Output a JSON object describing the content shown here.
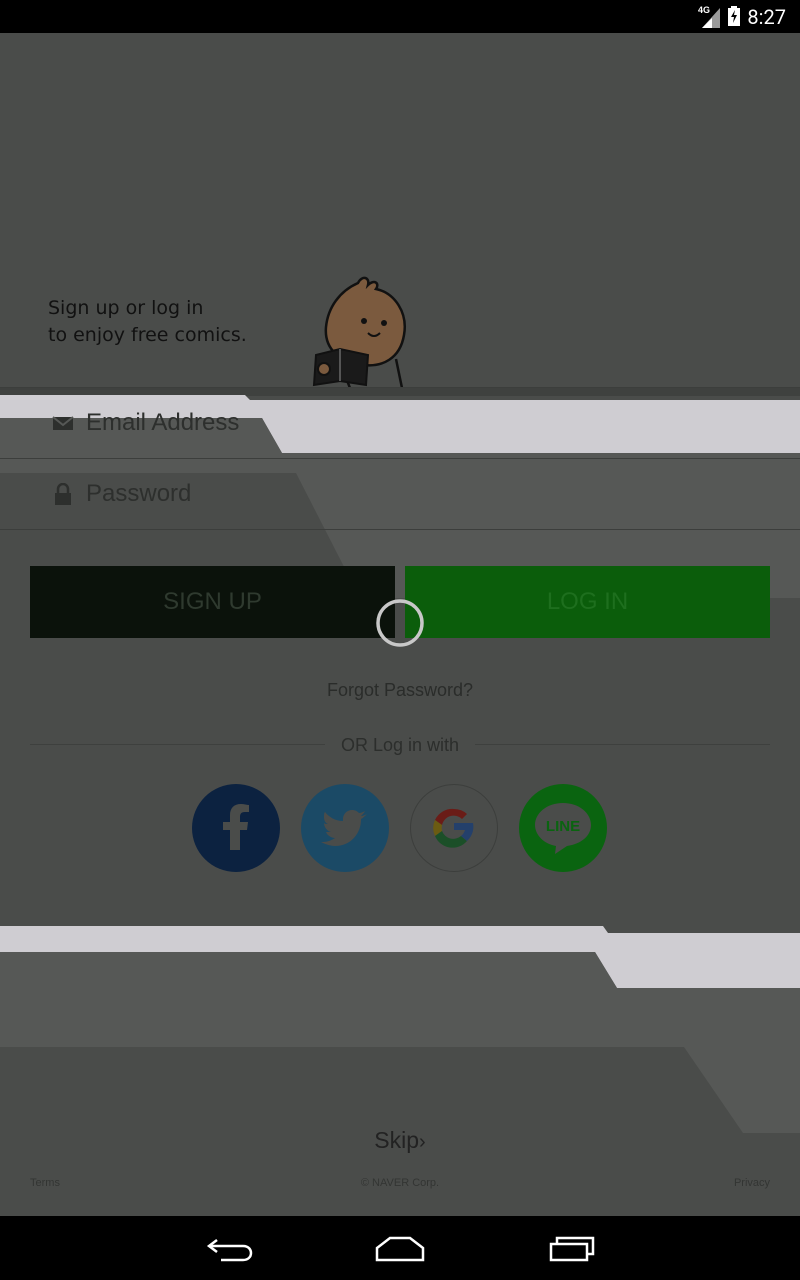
{
  "status_bar": {
    "network": "4G",
    "time": "8:27"
  },
  "intro": {
    "line1": "Sign up or log in",
    "line2": "to enjoy free comics."
  },
  "form": {
    "email_placeholder": "Email Address",
    "password_placeholder": "Password"
  },
  "buttons": {
    "signup": "SIGN UP",
    "login": "LOG IN"
  },
  "links": {
    "forgot": "Forgot Password?",
    "or_login": "OR Log in with",
    "skip": "Skip"
  },
  "social": {
    "facebook_icon": "facebook-icon",
    "twitter_icon": "twitter-icon",
    "google_icon": "google-icon",
    "line_icon": "line-icon",
    "line_label": "LINE"
  },
  "footer": {
    "terms": "Terms",
    "copyright": "© NAVER Corp.",
    "privacy": "Privacy"
  },
  "colors": {
    "overlay_bg": "#4a4c4a",
    "login_green": "#0b5d0b",
    "signup_dark": "#0b120b",
    "facebook": "#0c2240",
    "twitter": "#1b4a66",
    "line": "#0a6410"
  }
}
